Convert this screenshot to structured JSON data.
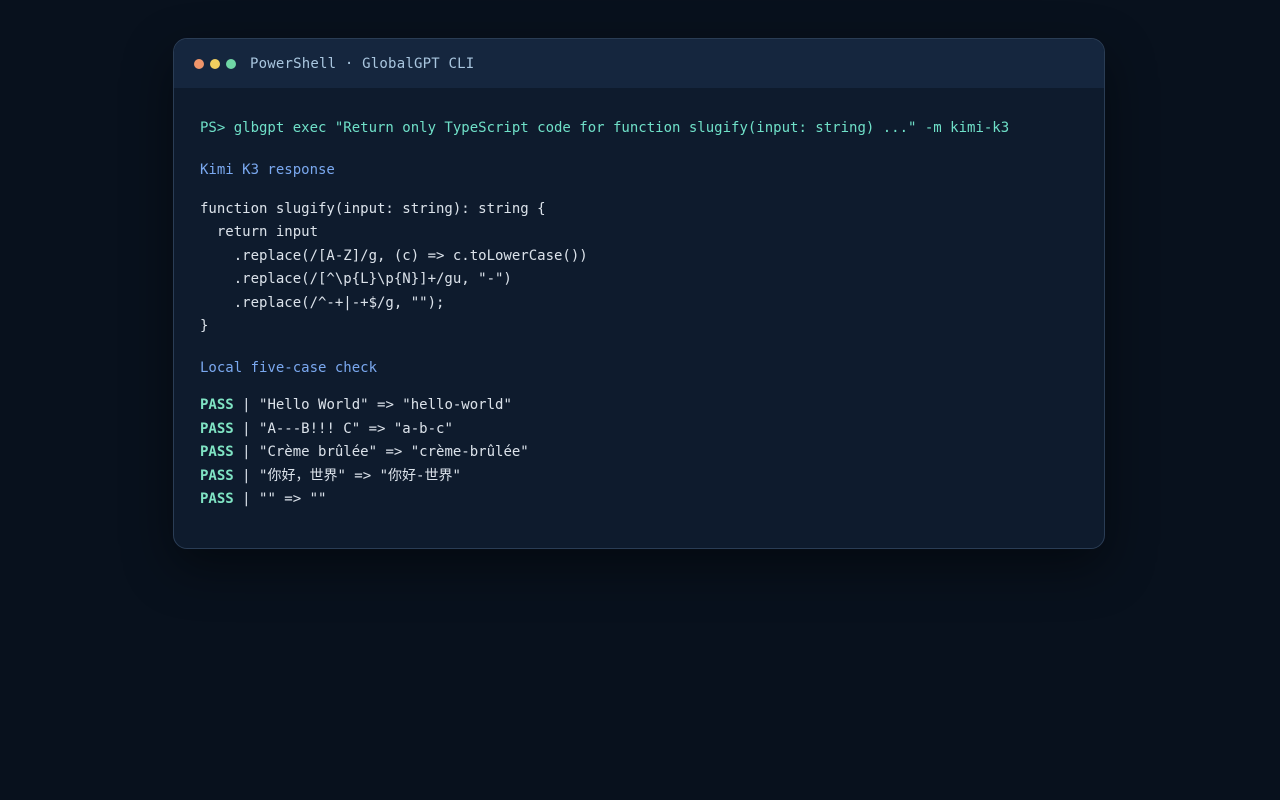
{
  "window": {
    "title": "PowerShell · GlobalGPT CLI",
    "dots": [
      {
        "name": "close",
        "color": "#f0956a"
      },
      {
        "name": "minimize",
        "color": "#f1cf5f"
      },
      {
        "name": "maximize",
        "color": "#6fd6a5"
      }
    ]
  },
  "terminal": {
    "command": "PS> glbgpt exec \"Return only TypeScript code for function slugify(input: string) ...\" -m kimi-k3",
    "response_heading": "Kimi K3 response",
    "code_lines": [
      "function slugify(input: string): string {",
      "  return input",
      "    .replace(/[A-Z]/g, (c) => c.toLowerCase())",
      "    .replace(/[^\\p{L}\\p{N}]+/gu, \"-\")",
      "    .replace(/^-+|-+$/g, \"\");",
      "}"
    ],
    "check_heading": "Local five-case check",
    "checks": [
      {
        "status": "PASS",
        "sep": " | ",
        "text": "\"Hello World\" => \"hello-world\""
      },
      {
        "status": "PASS",
        "sep": " | ",
        "text": "\"A---B!!! C\" => \"a-b-c\""
      },
      {
        "status": "PASS",
        "sep": " | ",
        "text": "\"Crème brûlée\" => \"crème-brûlée\""
      },
      {
        "status": "PASS",
        "sep": " | ",
        "text": "\"你好，世界\" => \"你好-世界\""
      },
      {
        "status": "PASS",
        "sep": " | ",
        "text": "\"\" => \"\""
      }
    ]
  }
}
